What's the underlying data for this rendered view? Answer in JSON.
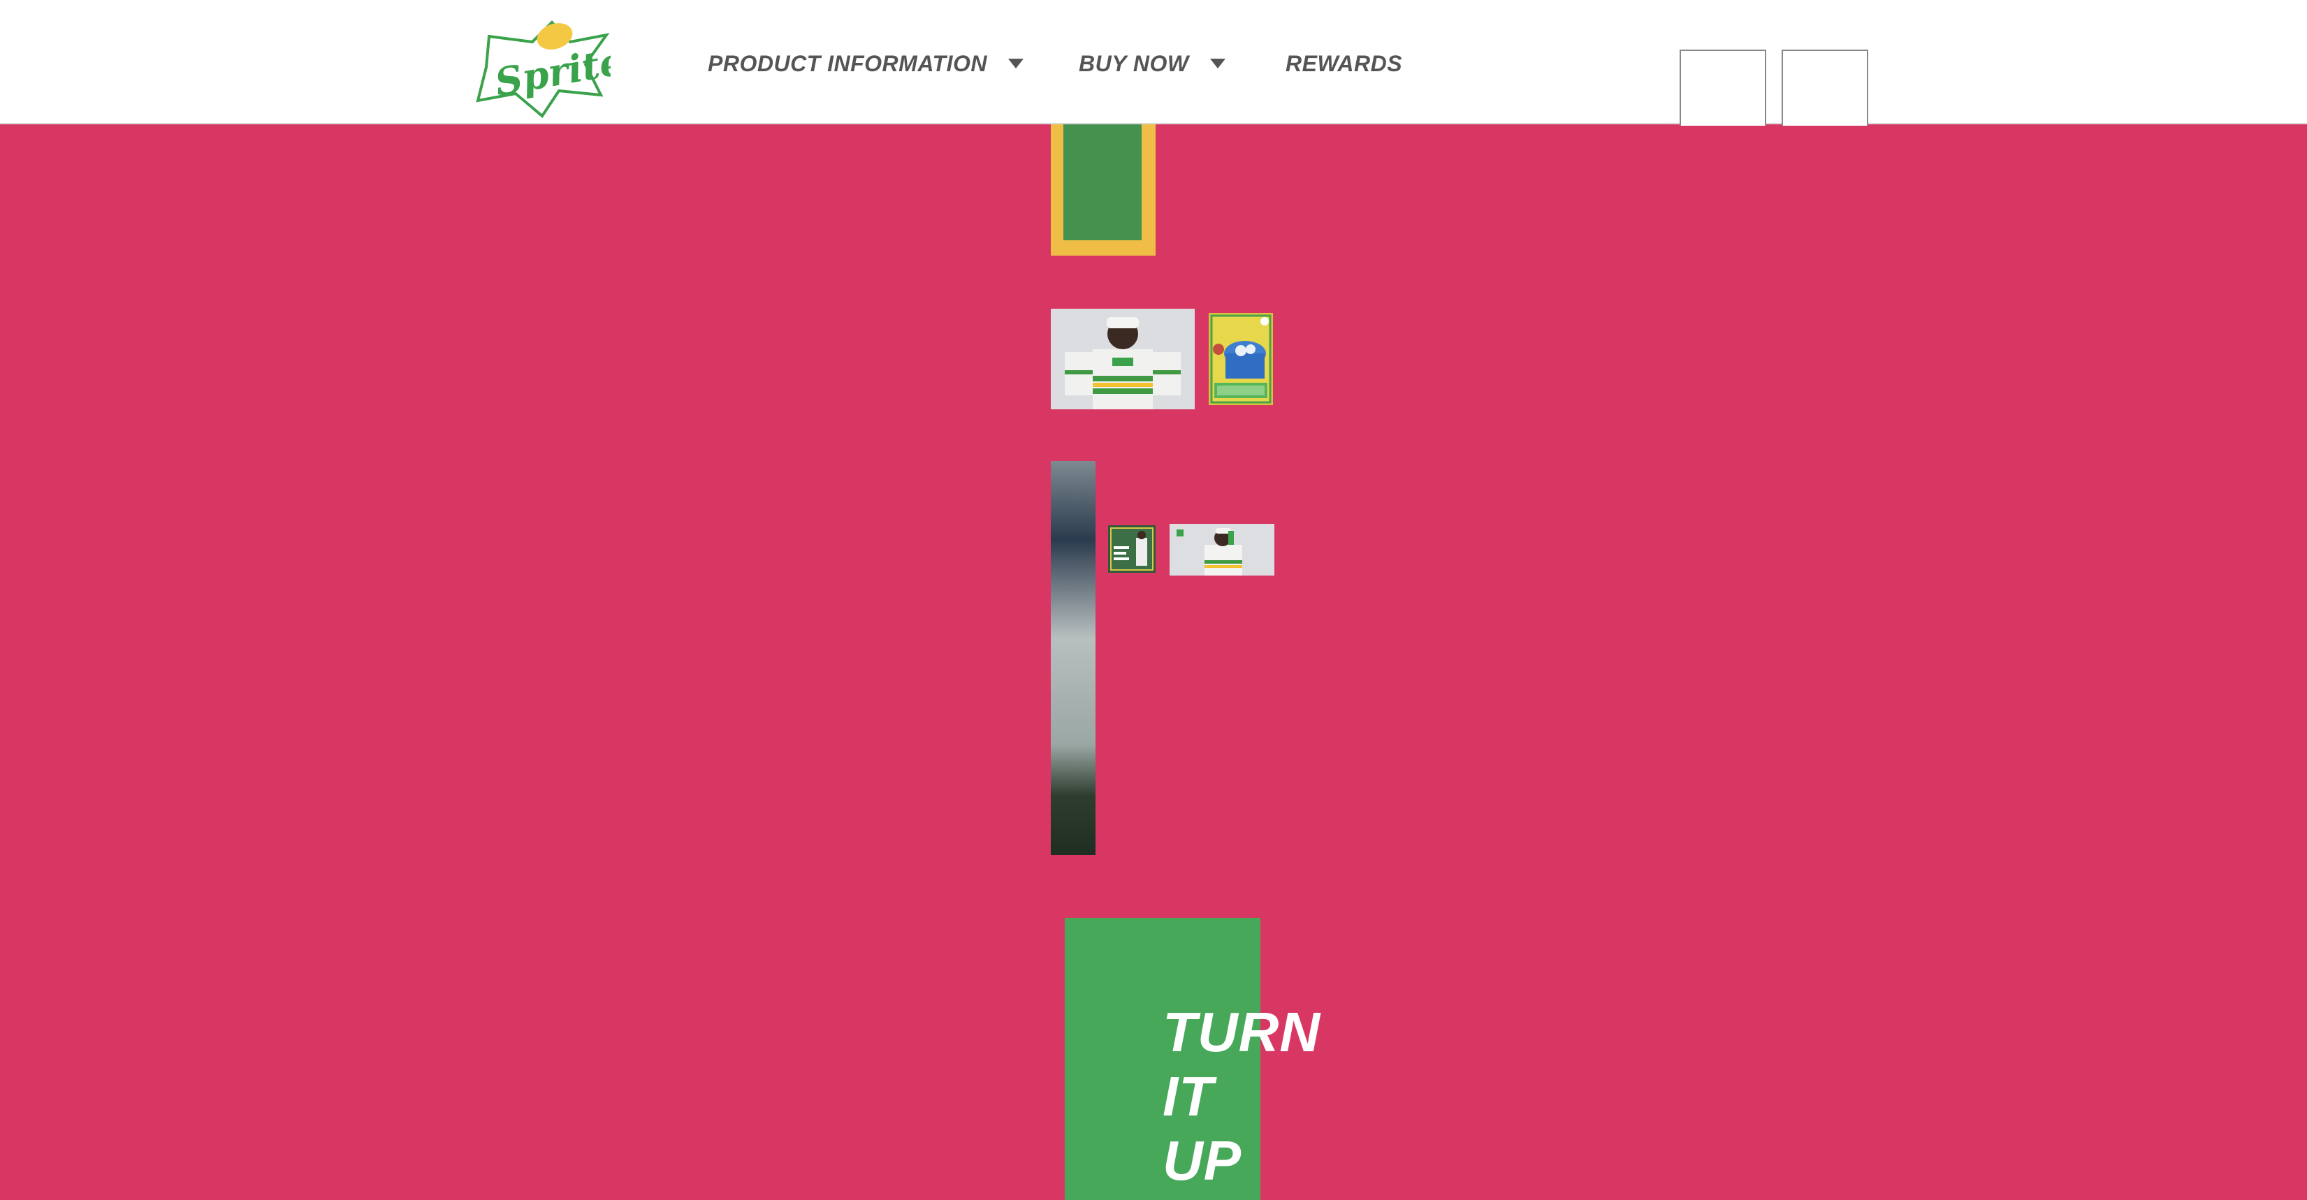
{
  "brand": {
    "name": "Sprite",
    "colors": {
      "green": "#3aa24a",
      "yellow": "#f5c844",
      "page_bg": "#d83763"
    }
  },
  "nav": {
    "product_information": "PRODUCT INFORMATION",
    "buy_now": "BUY NOW",
    "rewards": "REWARDS"
  },
  "images": {
    "player_jersey": "player in Sprite jersey",
    "poster": "Sprite poster with ice bucket",
    "stadium_strip": "stadium photo strip",
    "promo_card": "Sprite promo card",
    "player_drinking": "player drinking Sprite"
  },
  "headline": {
    "line1": "TURN",
    "line2": "IT",
    "line3": "UP"
  }
}
